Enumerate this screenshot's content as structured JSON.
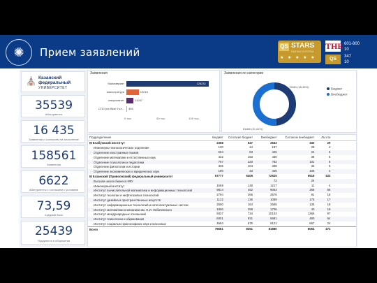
{
  "header": {
    "title": "Прием заявлений",
    "qs_label": "QS",
    "stars_label": "STARS",
    "stars_sub": "RATING SYSTEM",
    "stars_row": "★ ★ ★ ★ ★",
    "the_label": "THE",
    "qs_small_label": "QS",
    "rank_the": [
      "601-800",
      "10"
    ],
    "rank_qs": [
      "347",
      "10"
    ]
  },
  "brand": {
    "icon": "kfu-emblem",
    "name": "Казанский федеральный",
    "sub": "УНИВЕРСИТЕТ"
  },
  "kpis": [
    {
      "value": "35539",
      "label": "Абитуриенты"
    },
    {
      "value": "16 435",
      "label": "Заявления с согласием на зачисление"
    },
    {
      "value": "158561",
      "label": "Заявления"
    },
    {
      "value": "6622",
      "label": "Абитуриенты с согласием с условием"
    },
    {
      "value": "73,59",
      "label": "Средний балл"
    },
    {
      "value": "25439",
      "label": "Нуждаются в общежитии"
    }
  ],
  "panel_bars": {
    "title": "Заявления",
    "chart_data": {
      "type": "bar",
      "categories": [
        "бакалавриат",
        "магистратура",
        "специалитет",
        "СПО (на базе 9 кл..."
      ],
      "values": [
        128232,
        19215,
        11047,
        356
      ],
      "value_labels": [
        "128232",
        "19215",
        "11047",
        "356"
      ],
      "xticks": [
        "0 тыс.",
        "50 тыс.",
        "100 тыс."
      ],
      "xlim": [
        0,
        130000
      ],
      "colors": [
        "#1f3b73",
        "#e0653a",
        "#5b2d6e",
        "#e9ac45"
      ]
    }
  },
  "panel_donut": {
    "title": "Заявления по категории",
    "chart_data": {
      "type": "pie",
      "categories": [
        "Бюджет",
        "Внебюджет"
      ],
      "values": [
        76681,
        81880
      ],
      "value_labels": [
        "76681 (48,36%)",
        "81880 (51,64%)"
      ],
      "colors": [
        "#1f3b73",
        "#1a6fd1"
      ]
    }
  },
  "table": {
    "columns": [
      "Подразделение",
      "Бюджет",
      "Согласие бюджет",
      "Внебюджет",
      "Согласие внебюджет",
      "Льгота",
      ""
    ],
    "rows": [
      {
        "kind": "grp",
        "name": "Елабужский институт",
        "b": "2358",
        "sb": "647",
        "v": "2633",
        "sv": "330",
        "l": "29"
      },
      {
        "kind": "row",
        "name": "Инженерно-технологическое отделение",
        "b": "130",
        "sb": "44",
        "v": "187",
        "sv": "28",
        "l": "4"
      },
      {
        "kind": "row",
        "name": "Отделение иностранных языков",
        "b": "504",
        "sb": "83",
        "v": "445",
        "sv": "24",
        "l": "5"
      },
      {
        "kind": "row",
        "name": "Отделение математики и естественных наук",
        "b": "432",
        "sb": "153",
        "v": "435",
        "sv": "38",
        "l": "6"
      },
      {
        "kind": "row",
        "name": "Отделение психологии и педагогики",
        "b": "767",
        "sb": "220",
        "v": "782",
        "sv": "101",
        "l": "8"
      },
      {
        "kind": "row",
        "name": "Отделение филологии и истории",
        "b": "335",
        "sb": "104",
        "v": "338",
        "sv": "33",
        "l": "5"
      },
      {
        "kind": "row",
        "name": "Отделение экономических и юридических наук",
        "b": "190",
        "sb": "43",
        "v": "446",
        "sv": "106",
        "l": "4"
      },
      {
        "kind": "grp",
        "name": "Казанский (Приволжский) федеральный университет",
        "b": "67777",
        "sb": "6409",
        "v": "72625",
        "sv": "6519",
        "l": "433"
      },
      {
        "kind": "row",
        "name": "Высшая школа бизнеса КФУ",
        "b": "",
        "sb": "",
        "v": "72",
        "sv": "24",
        "l": ""
      },
      {
        "kind": "row",
        "name": "Инженерный институт",
        "b": "1559",
        "sb": "148",
        "v": "1217",
        "sv": "11",
        "l": "4"
      },
      {
        "kind": "row",
        "name": "Институт вычислительной математики и информационных технологий",
        "b": "9814",
        "sb": "452",
        "v": "9053",
        "sv": "268",
        "l": "66"
      },
      {
        "kind": "row",
        "name": "Институт геологии и нефтегазовых технологий",
        "b": "2794",
        "sb": "266",
        "v": "2576",
        "sv": "91",
        "l": "18"
      },
      {
        "kind": "row",
        "name": "Институт дизайна и пространственных искусств",
        "b": "1132",
        "sb": "136",
        "v": "1089",
        "sv": "175",
        "l": "17"
      },
      {
        "kind": "row",
        "name": "Институт информационных технологий и интеллектуальных систем",
        "b": "2600",
        "sb": "164",
        "v": "2665",
        "sv": "135",
        "l": "18"
      },
      {
        "kind": "row",
        "name": "Институт математики и механики им. Н.И. Лобачевского",
        "b": "1900",
        "sb": "258",
        "v": "1706",
        "sv": "40",
        "l": "19"
      },
      {
        "kind": "row",
        "name": "Институт международных отношений",
        "b": "9337",
        "sb": "734",
        "v": "10103",
        "sv": "1266",
        "l": "97"
      },
      {
        "kind": "row",
        "name": "Институт психологии и образования",
        "b": "6001",
        "sb": "931",
        "v": "5681",
        "sv": "480",
        "l": "64"
      },
      {
        "kind": "row",
        "name": "Институт социально-философских наук и массовых",
        "b": "4664",
        "sb": "676",
        "v": "6121",
        "sv": "667",
        "l": "24"
      },
      {
        "kind": "total",
        "name": "Всего",
        "b": "76681",
        "sb": "8351",
        "v": "81880",
        "sv": "8064",
        "l": "472"
      }
    ]
  }
}
